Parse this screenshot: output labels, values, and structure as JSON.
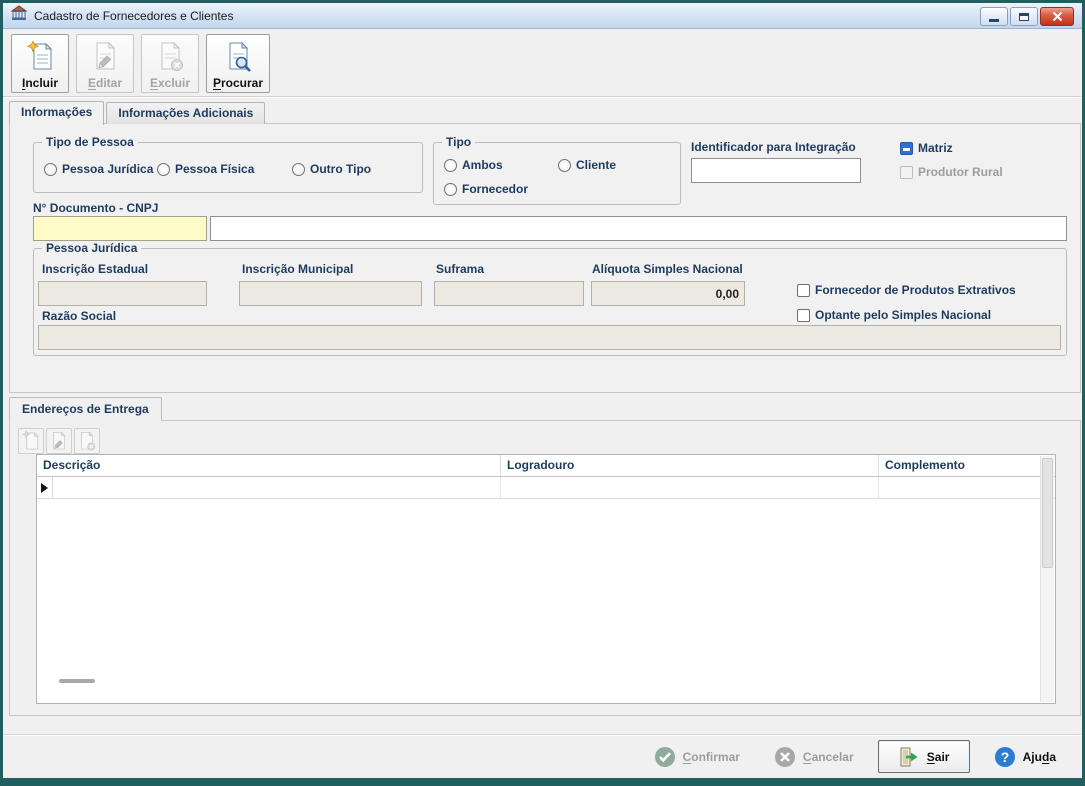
{
  "window": {
    "title": "Cadastro de Fornecedores e Clientes",
    "icons": {
      "app": "bank-building-icon",
      "minimize": "minimize-icon",
      "maximize": "maximize-icon",
      "close": "close-icon"
    }
  },
  "toolbar": {
    "buttons": [
      {
        "id": "incluir",
        "pre": "",
        "accel": "I",
        "post": "ncluir",
        "icon": "document-new-icon",
        "enabled": true
      },
      {
        "id": "editar",
        "pre": "",
        "accel": "E",
        "post": "ditar",
        "icon": "document-edit-icon",
        "enabled": false
      },
      {
        "id": "excluir",
        "pre": "",
        "accel": "E",
        "post": "xcluir",
        "icon": "document-delete-icon",
        "enabled": false
      },
      {
        "id": "procurar",
        "pre": "",
        "accel": "P",
        "post": "rocurar",
        "icon": "document-search-icon",
        "enabled": true
      }
    ]
  },
  "tabs": [
    {
      "label": "Informações",
      "active": true
    },
    {
      "label": "Informações Adicionais",
      "active": false
    }
  ],
  "form": {
    "tipo_pessoa": {
      "legend": "Tipo de Pessoa",
      "options": [
        {
          "label": "Pessoa Jurídica",
          "selected": false
        },
        {
          "label": "Pessoa Física",
          "selected": false
        },
        {
          "label": "Outro Tipo",
          "selected": false
        }
      ]
    },
    "tipo": {
      "legend": "Tipo",
      "options": [
        {
          "label": "Ambos",
          "selected": false
        },
        {
          "label": "Cliente",
          "selected": false
        },
        {
          "label": "Fornecedor",
          "selected": false
        }
      ]
    },
    "identificador": {
      "label": "Identificador para Integração",
      "value": ""
    },
    "matriz": {
      "label": "Matriz",
      "checked": true
    },
    "produtor_rural": {
      "label": "Produtor Rural",
      "checked": false,
      "enabled": false
    },
    "documento": {
      "label": "N° Documento - CNPJ",
      "numero": "",
      "nome": ""
    },
    "pessoa_juridica": {
      "legend": "Pessoa Jurídica",
      "inscricao_estadual": {
        "label": "Inscrição Estadual",
        "value": ""
      },
      "inscricao_municipal": {
        "label": "Inscrição Municipal",
        "value": ""
      },
      "suframa": {
        "label": "Suframa",
        "value": ""
      },
      "aliquota_simples": {
        "label": "Alíquota Simples Nacional",
        "value": "0,00"
      },
      "fornecedor_extrativos": {
        "label": "Fornecedor de Produtos Extrativos",
        "checked": false
      },
      "optante_simples": {
        "label": "Optante pelo Simples Nacional",
        "checked": false
      },
      "razao_social": {
        "label": "Razão Social",
        "value": ""
      }
    }
  },
  "enderecos": {
    "tab_label": "Endereços de Entrega",
    "toolbar_icons": [
      "row-new-icon",
      "row-edit-icon",
      "row-delete-icon"
    ],
    "grid": {
      "columns": [
        "Descrição",
        "Logradouro",
        "Complemento"
      ],
      "rows": [
        {
          "descricao": "",
          "logradouro": "",
          "complemento": ""
        }
      ]
    }
  },
  "footer": {
    "buttons": [
      {
        "id": "confirmar",
        "pre": "",
        "accel": "C",
        "post": "onfirmar",
        "icon": "check-circle-icon",
        "enabled": false
      },
      {
        "id": "cancelar",
        "pre": "",
        "accel": "C",
        "post": "ancelar",
        "icon": "x-circle-icon",
        "enabled": false
      },
      {
        "id": "sair",
        "pre": "",
        "accel": "S",
        "post": "air",
        "icon": "exit-door-icon",
        "enabled": true
      },
      {
        "id": "ajuda",
        "pre": "Aju",
        "accel": "d",
        "post": "a",
        "icon": "help-circle-icon",
        "enabled": true
      }
    ]
  },
  "colors": {
    "window_border": "#215e60",
    "titlebar_top": "#ecf4fc",
    "titlebar_bottom": "#c1d6ee",
    "accent_blue": "#2f6fd6",
    "field_yellow": "#fdfbc8",
    "disabled_field": "#ebe9e0",
    "label_text": "#1e3a5f",
    "help_blue": "#2b7cd3",
    "confirm_green": "#8fab9c",
    "close_red": "#c0311c"
  }
}
